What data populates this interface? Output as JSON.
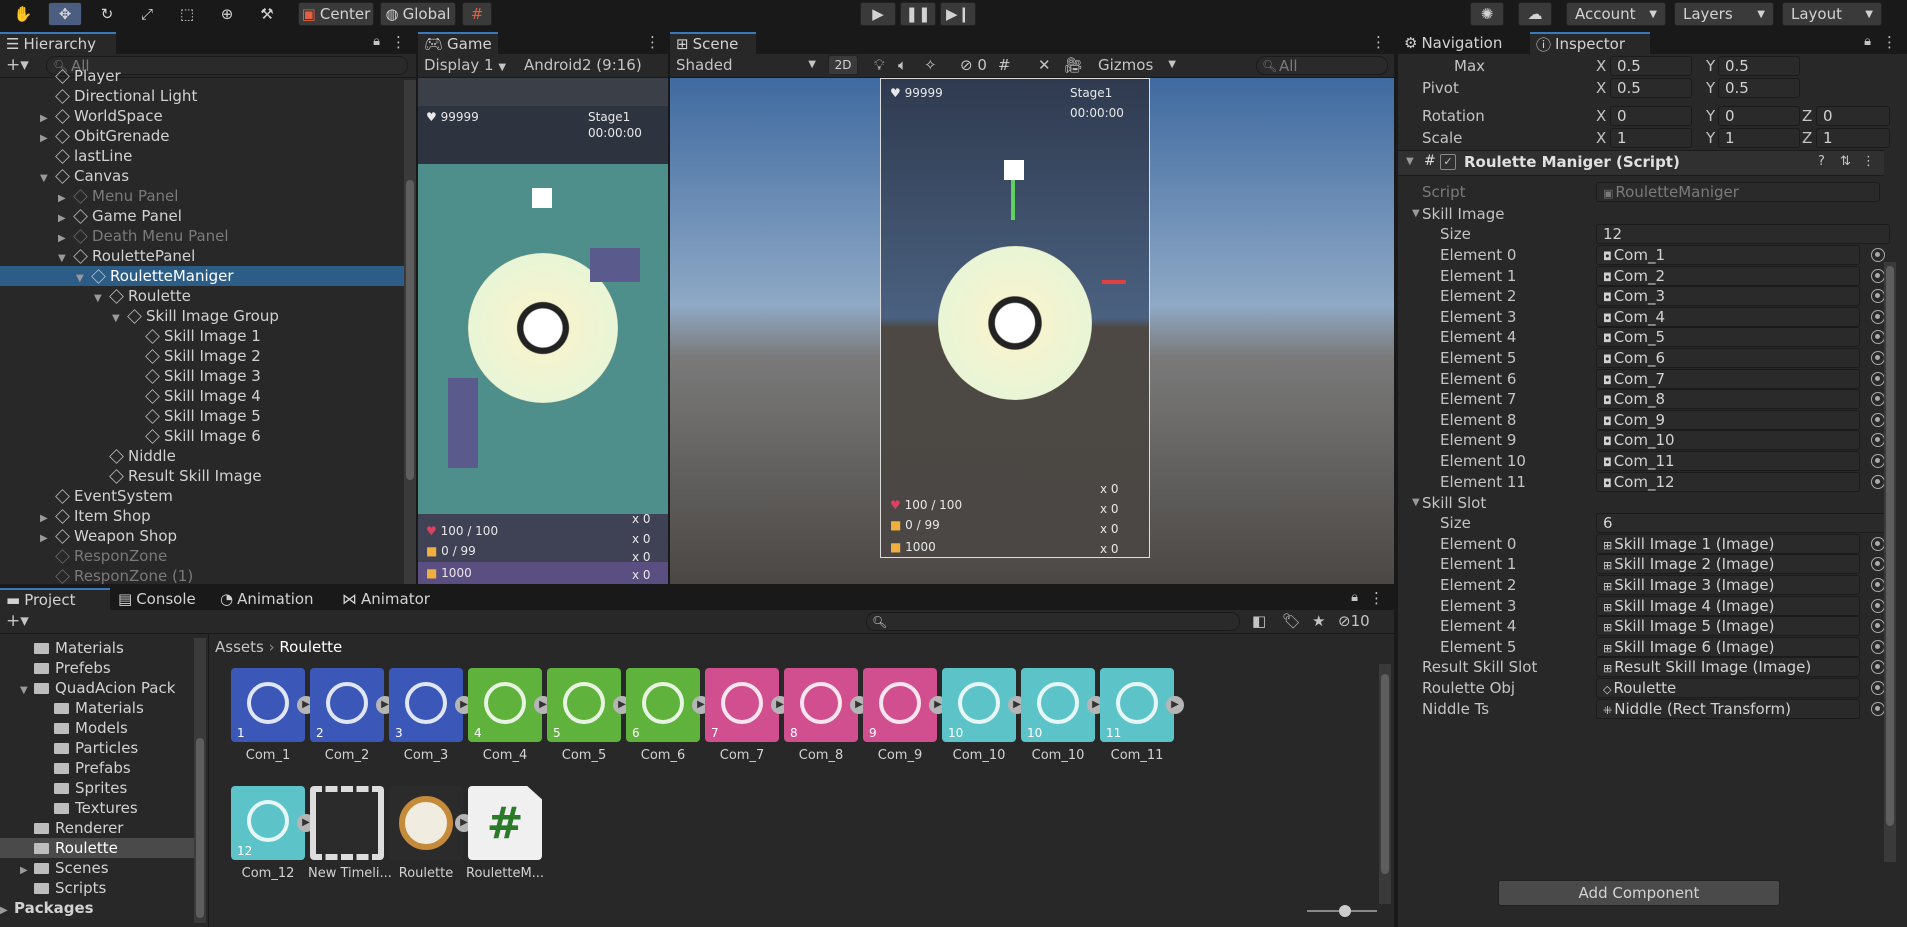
{
  "toolbar": {
    "center": "Center",
    "global": "Global",
    "account": "Account",
    "layers": "Layers",
    "layout": "Layout"
  },
  "hierarchy": {
    "tab": "Hierarchy",
    "search_placeholder": "All",
    "items": [
      {
        "label": "Player",
        "indent": 0,
        "dim": false,
        "arrow": ""
      },
      {
        "label": "Directional Light",
        "indent": 0,
        "dim": false,
        "arrow": ""
      },
      {
        "label": "WorldSpace",
        "indent": 0,
        "dim": false,
        "arrow": "▶"
      },
      {
        "label": "ObitGrenade",
        "indent": 0,
        "dim": false,
        "arrow": "▶"
      },
      {
        "label": "lastLine",
        "indent": 0,
        "dim": false,
        "arrow": ""
      },
      {
        "label": "Canvas",
        "indent": 0,
        "dim": false,
        "arrow": "▼"
      },
      {
        "label": "Menu Panel",
        "indent": 1,
        "dim": true,
        "arrow": "▶"
      },
      {
        "label": "Game Panel",
        "indent": 1,
        "dim": false,
        "arrow": "▶"
      },
      {
        "label": "Death Menu Panel",
        "indent": 1,
        "dim": true,
        "arrow": "▶"
      },
      {
        "label": "RoulettePanel",
        "indent": 1,
        "dim": false,
        "arrow": "▼"
      },
      {
        "label": "RouletteManiger",
        "indent": 2,
        "dim": false,
        "arrow": "▼",
        "selected": true
      },
      {
        "label": "Roulette",
        "indent": 3,
        "dim": false,
        "arrow": "▼"
      },
      {
        "label": "Skill Image Group",
        "indent": 4,
        "dim": false,
        "arrow": "▼"
      },
      {
        "label": "Skill Image 1",
        "indent": 5,
        "dim": false,
        "arrow": ""
      },
      {
        "label": "Skill Image 2",
        "indent": 5,
        "dim": false,
        "arrow": ""
      },
      {
        "label": "Skill Image 3",
        "indent": 5,
        "dim": false,
        "arrow": ""
      },
      {
        "label": "Skill Image 4",
        "indent": 5,
        "dim": false,
        "arrow": ""
      },
      {
        "label": "Skill Image 5",
        "indent": 5,
        "dim": false,
        "arrow": ""
      },
      {
        "label": "Skill Image 6",
        "indent": 5,
        "dim": false,
        "arrow": ""
      },
      {
        "label": "Niddle",
        "indent": 3,
        "dim": false,
        "arrow": ""
      },
      {
        "label": "Result Skill Image",
        "indent": 3,
        "dim": false,
        "arrow": ""
      },
      {
        "label": "EventSystem",
        "indent": 0,
        "dim": false,
        "arrow": ""
      },
      {
        "label": "Item Shop",
        "indent": 0,
        "dim": false,
        "arrow": "▶"
      },
      {
        "label": "Weapon Shop",
        "indent": 0,
        "dim": false,
        "arrow": "▶"
      },
      {
        "label": "ResponZone",
        "indent": 0,
        "dim": true,
        "arrow": ""
      },
      {
        "label": "ResponZone (1)",
        "indent": 0,
        "dim": true,
        "arrow": ""
      }
    ]
  },
  "game": {
    "tab": "Game",
    "display": "Display 1",
    "aspect": "Android2 (9:16)",
    "score": "99999",
    "stage": "Stage1",
    "time": "00:00:00",
    "hp": "100 / 100",
    "ammo": "0 / 99",
    "gold": "1000",
    "x0": "x 0"
  },
  "scene": {
    "tab": "Scene",
    "shading": "Shaded",
    "mode2d": "2D",
    "vis_count": "0",
    "gizmos": "Gizmos",
    "search_placeholder": "All",
    "score": "99999",
    "stage": "Stage1",
    "time": "00:00:00",
    "hp": "100 / 100",
    "ammo": "0 / 99",
    "gold": "1000",
    "x0": "x 0"
  },
  "inspector": {
    "tabs": {
      "navigation": "Navigation",
      "inspector": "Inspector"
    },
    "max": {
      "label": "Max",
      "x": "0.5",
      "y": "0.5"
    },
    "pivot": {
      "label": "Pivot",
      "x": "0.5",
      "y": "0.5"
    },
    "rotation": {
      "label": "Rotation",
      "x": "0",
      "y": "0",
      "z": "0"
    },
    "scale": {
      "label": "Scale",
      "x": "1",
      "y": "1",
      "z": "1"
    },
    "component": "Roulette Maniger (Script)",
    "script_label": "Script",
    "script_value": "RouletteManiger",
    "skill_image": {
      "label": "Skill Image",
      "size_label": "Size",
      "size": "12",
      "elements": [
        [
          "Element 0",
          "Com_1"
        ],
        [
          "Element 1",
          "Com_2"
        ],
        [
          "Element 2",
          "Com_3"
        ],
        [
          "Element 3",
          "Com_4"
        ],
        [
          "Element 4",
          "Com_5"
        ],
        [
          "Element 5",
          "Com_6"
        ],
        [
          "Element 6",
          "Com_7"
        ],
        [
          "Element 7",
          "Com_8"
        ],
        [
          "Element 8",
          "Com_9"
        ],
        [
          "Element 9",
          "Com_10"
        ],
        [
          "Element 10",
          "Com_11"
        ],
        [
          "Element 11",
          "Com_12"
        ]
      ]
    },
    "skill_slot": {
      "label": "Skill Slot",
      "size_label": "Size",
      "size": "6",
      "elements": [
        [
          "Element 0",
          "Skill Image 1 (Image)"
        ],
        [
          "Element 1",
          "Skill Image 2 (Image)"
        ],
        [
          "Element 2",
          "Skill Image 3 (Image)"
        ],
        [
          "Element 3",
          "Skill Image 4 (Image)"
        ],
        [
          "Element 4",
          "Skill Image 5 (Image)"
        ],
        [
          "Element 5",
          "Skill Image 6 (Image)"
        ]
      ]
    },
    "result_skill_slot": {
      "label": "Result Skill Slot",
      "value": "Result Skill Image (Image)"
    },
    "roulette_obj": {
      "label": "Roulette Obj",
      "value": "Roulette"
    },
    "niddle_ts": {
      "label": "Niddle Ts",
      "value": "Niddle (Rect Transform)"
    },
    "add_component": "Add Component"
  },
  "project": {
    "tabs": {
      "project": "Project",
      "console": "Console",
      "animation": "Animation",
      "animator": "Animator"
    },
    "hidden_count": "10",
    "breadcrumb": {
      "root": "Assets",
      "current": "Roulette"
    },
    "tree": [
      {
        "label": "Materials",
        "indent": 1,
        "arrow": ""
      },
      {
        "label": "Prefebs",
        "indent": 1,
        "arrow": ""
      },
      {
        "label": "QuadAcion Pack",
        "indent": 1,
        "arrow": "▼"
      },
      {
        "label": "Materials",
        "indent": 2,
        "arrow": ""
      },
      {
        "label": "Models",
        "indent": 2,
        "arrow": ""
      },
      {
        "label": "Particles",
        "indent": 2,
        "arrow": ""
      },
      {
        "label": "Prefabs",
        "indent": 2,
        "arrow": ""
      },
      {
        "label": "Sprites",
        "indent": 2,
        "arrow": ""
      },
      {
        "label": "Textures",
        "indent": 2,
        "arrow": ""
      },
      {
        "label": "Renderer",
        "indent": 1,
        "arrow": ""
      },
      {
        "label": "Roulette",
        "indent": 1,
        "arrow": "",
        "selected": true
      },
      {
        "label": "Scenes",
        "indent": 1,
        "arrow": "▶"
      },
      {
        "label": "Scripts",
        "indent": 1,
        "arrow": ""
      },
      {
        "label": "Packages",
        "indent": 0,
        "arrow": "▶"
      }
    ],
    "assets": [
      {
        "name": "Com_1",
        "color": "#3b58b8",
        "num": "1"
      },
      {
        "name": "Com_2",
        "color": "#3b58b8",
        "num": "2"
      },
      {
        "name": "Com_3",
        "color": "#3b58b8",
        "num": "3"
      },
      {
        "name": "Com_4",
        "color": "#5fb23c",
        "num": "4"
      },
      {
        "name": "Com_5",
        "color": "#5fb23c",
        "num": "5"
      },
      {
        "name": "Com_6",
        "color": "#5fb23c",
        "num": "6"
      },
      {
        "name": "Com_7",
        "color": "#d14f8f",
        "num": "7"
      },
      {
        "name": "Com_8",
        "color": "#d14f8f",
        "num": "8"
      },
      {
        "name": "Com_9",
        "color": "#d14f8f",
        "num": "9"
      },
      {
        "name": "Com_10",
        "color": "#5cc4c9",
        "num": "10"
      },
      {
        "name": "Com_10",
        "color": "#5cc4c9",
        "num": "10"
      },
      {
        "name": "Com_11",
        "color": "#5cc4c9",
        "num": "11"
      },
      {
        "name": "Com_12",
        "color": "#5cc4c9",
        "num": "12"
      },
      {
        "name": "New Timeli...",
        "color": "#2b2b2b",
        "num": ""
      },
      {
        "name": "Roulette",
        "color": "#2b2b2b",
        "num": ""
      },
      {
        "name": "RouletteM...",
        "color": "#f0f0f0",
        "num": ""
      }
    ]
  }
}
